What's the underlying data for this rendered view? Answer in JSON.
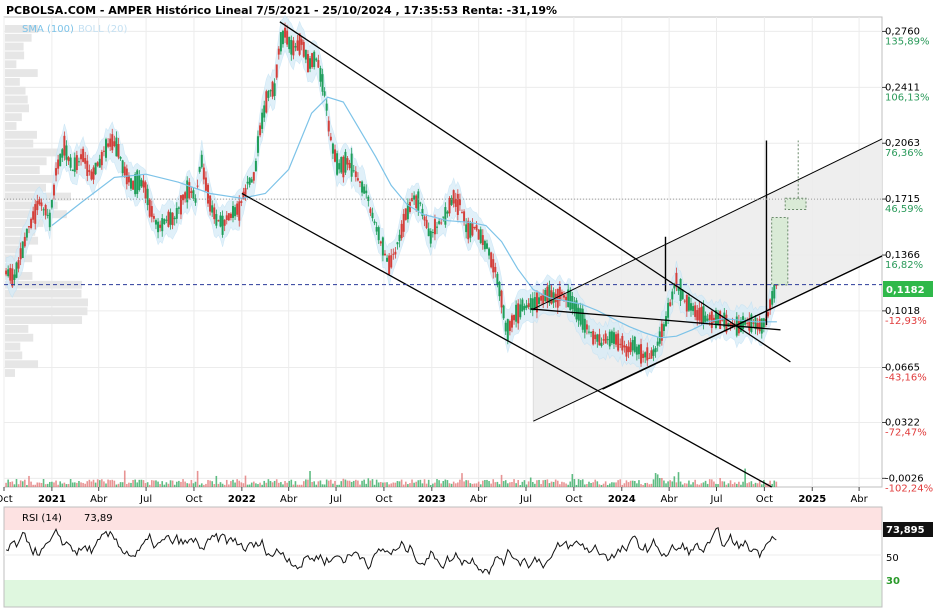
{
  "header": {
    "title": "PCBOLSA.COM - AMPER Histórico Lineal 7/5/2021 - 25/10/2024 , 17:35:53 Renta: -31,19%",
    "legend": [
      {
        "label": "SMA (100)",
        "color": "#7dc3e8"
      },
      {
        "label": "BOLL (20)",
        "color": "#c4e0f2"
      }
    ]
  },
  "chart_data": [
    {
      "type": "candlestick",
      "title": "PCBOLSA.COM - AMPER Histórico Lineal 7/5/2021 - 25/10/2024 , 17:35:53 Renta: -31,19%",
      "x_range": [
        "2020-10-01",
        "2025-05-15"
      ],
      "ylim": [
        -0.008,
        0.285
      ],
      "current_price": {
        "value": 0.1182,
        "label": "0,1182"
      },
      "price_ticks": [
        {
          "value": 0.276,
          "label": "0,2760",
          "pct": "135,89%",
          "color": "#2a9a5a"
        },
        {
          "value": 0.2411,
          "label": "0,2411",
          "pct": "106,13%",
          "color": "#2a9a5a"
        },
        {
          "value": 0.2063,
          "label": "0,2063",
          "pct": "76,36%",
          "color": "#2a9a5a"
        },
        {
          "value": 0.1715,
          "label": "0,1715",
          "pct": "46,59%",
          "color": "#2a9a5a"
        },
        {
          "value": 0.1366,
          "label": "0,1366",
          "pct": "16,82%",
          "color": "#2a9a5a"
        },
        {
          "value": 0.1018,
          "label": "0,1018",
          "pct": "-12,93%",
          "color": "#e03c3c"
        },
        {
          "value": 0.0665,
          "label": "0,0665",
          "pct": "-43,16%",
          "color": "#e03c3c"
        },
        {
          "value": 0.0322,
          "label": "0,0322",
          "pct": "-72,47%",
          "color": "#e03c3c"
        },
        {
          "value": -0.0026,
          "label": "-0,0026",
          "pct": "-102,24%",
          "color": "#e03c3c"
        }
      ],
      "x_ticks": [
        {
          "date": "2020-10-01",
          "label": "Oct",
          "bold": false
        },
        {
          "date": "2021-01-01",
          "label": "2021",
          "bold": true
        },
        {
          "date": "2021-04-01",
          "label": "Abr",
          "bold": false
        },
        {
          "date": "2021-07-01",
          "label": "Jul",
          "bold": false
        },
        {
          "date": "2021-10-01",
          "label": "Oct",
          "bold": false
        },
        {
          "date": "2022-01-01",
          "label": "2022",
          "bold": true
        },
        {
          "date": "2022-04-01",
          "label": "Abr",
          "bold": false
        },
        {
          "date": "2022-07-01",
          "label": "Jul",
          "bold": false
        },
        {
          "date": "2022-10-01",
          "label": "Oct",
          "bold": false
        },
        {
          "date": "2023-01-01",
          "label": "2023",
          "bold": true
        },
        {
          "date": "2023-04-01",
          "label": "Abr",
          "bold": false
        },
        {
          "date": "2023-07-01",
          "label": "Jul",
          "bold": false
        },
        {
          "date": "2023-10-01",
          "label": "Oct",
          "bold": false
        },
        {
          "date": "2024-01-01",
          "label": "2024",
          "bold": true
        },
        {
          "date": "2024-04-01",
          "label": "Abr",
          "bold": false
        },
        {
          "date": "2024-07-01",
          "label": "Jul",
          "bold": false
        },
        {
          "date": "2024-10-01",
          "label": "Oct",
          "bold": false
        },
        {
          "date": "2025-01-01",
          "label": "2025",
          "bold": true
        },
        {
          "date": "2025-04-01",
          "label": "Abr",
          "bold": false
        }
      ],
      "price_path": [
        [
          "2020-10-01",
          0.128
        ],
        [
          "2020-10-20",
          0.122
        ],
        [
          "2020-11-10",
          0.145
        ],
        [
          "2020-11-25",
          0.16
        ],
        [
          "2020-12-10",
          0.17
        ],
        [
          "2020-12-28",
          0.158
        ],
        [
          "2021-01-10",
          0.19
        ],
        [
          "2021-01-25",
          0.205
        ],
        [
          "2021-02-10",
          0.19
        ],
        [
          "2021-03-01",
          0.198
        ],
        [
          "2021-03-20",
          0.185
        ],
        [
          "2021-04-10",
          0.2
        ],
        [
          "2021-04-25",
          0.208
        ],
        [
          "2021-05-10",
          0.2
        ],
        [
          "2021-05-25",
          0.185
        ],
        [
          "2021-06-10",
          0.18
        ],
        [
          "2021-06-25",
          0.182
        ],
        [
          "2021-07-10",
          0.165
        ],
        [
          "2021-07-25",
          0.153
        ],
        [
          "2021-08-10",
          0.16
        ],
        [
          "2021-08-25",
          0.158
        ],
        [
          "2021-09-10",
          0.172
        ],
        [
          "2021-09-25",
          0.178
        ],
        [
          "2021-10-05",
          0.17
        ],
        [
          "2021-10-15",
          0.198
        ],
        [
          "2021-10-25",
          0.178
        ],
        [
          "2021-11-10",
          0.16
        ],
        [
          "2021-11-25",
          0.155
        ],
        [
          "2021-12-10",
          0.162
        ],
        [
          "2021-12-28",
          0.165
        ],
        [
          "2022-01-10",
          0.18
        ],
        [
          "2022-01-25",
          0.185
        ],
        [
          "2022-02-05",
          0.215
        ],
        [
          "2022-02-20",
          0.238
        ],
        [
          "2022-03-05",
          0.24
        ],
        [
          "2022-03-15",
          0.268
        ],
        [
          "2022-03-25",
          0.275
        ],
        [
          "2022-04-10",
          0.265
        ],
        [
          "2022-04-25",
          0.27
        ],
        [
          "2022-05-10",
          0.255
        ],
        [
          "2022-05-25",
          0.26
        ],
        [
          "2022-06-10",
          0.235
        ],
        [
          "2022-06-20",
          0.21
        ],
        [
          "2022-07-05",
          0.19
        ],
        [
          "2022-07-25",
          0.195
        ],
        [
          "2022-08-10",
          0.185
        ],
        [
          "2022-08-25",
          0.178
        ],
        [
          "2022-09-10",
          0.16
        ],
        [
          "2022-09-25",
          0.145
        ],
        [
          "2022-10-10",
          0.13
        ],
        [
          "2022-10-25",
          0.14
        ],
        [
          "2022-11-10",
          0.16
        ],
        [
          "2022-11-25",
          0.172
        ],
        [
          "2022-12-10",
          0.168
        ],
        [
          "2022-12-28",
          0.148
        ],
        [
          "2023-01-10",
          0.155
        ],
        [
          "2023-01-25",
          0.16
        ],
        [
          "2023-02-10",
          0.172
        ],
        [
          "2023-02-25",
          0.168
        ],
        [
          "2023-03-10",
          0.152
        ],
        [
          "2023-03-25",
          0.155
        ],
        [
          "2023-04-05",
          0.148
        ],
        [
          "2023-04-20",
          0.14
        ],
        [
          "2023-05-05",
          0.125
        ],
        [
          "2023-05-15",
          0.11
        ],
        [
          "2023-05-25",
          0.088
        ],
        [
          "2023-06-10",
          0.098
        ],
        [
          "2023-06-25",
          0.105
        ],
        [
          "2023-07-10",
          0.105
        ],
        [
          "2023-07-25",
          0.108
        ],
        [
          "2023-08-10",
          0.112
        ],
        [
          "2023-08-25",
          0.11
        ],
        [
          "2023-09-10",
          0.112
        ],
        [
          "2023-09-25",
          0.108
        ],
        [
          "2023-10-10",
          0.1
        ],
        [
          "2023-10-25",
          0.092
        ],
        [
          "2023-11-10",
          0.085
        ],
        [
          "2023-11-25",
          0.082
        ],
        [
          "2023-12-10",
          0.085
        ],
        [
          "2023-12-28",
          0.082
        ],
        [
          "2024-01-10",
          0.078
        ],
        [
          "2024-01-25",
          0.08
        ],
        [
          "2024-02-10",
          0.075
        ],
        [
          "2024-02-25",
          0.073
        ],
        [
          "2024-03-10",
          0.08
        ],
        [
          "2024-03-25",
          0.095
        ],
        [
          "2024-04-05",
          0.11
        ],
        [
          "2024-04-15",
          0.12
        ],
        [
          "2024-04-25",
          0.112
        ],
        [
          "2024-05-10",
          0.105
        ],
        [
          "2024-05-25",
          0.1
        ],
        [
          "2024-06-10",
          0.098
        ],
        [
          "2024-06-25",
          0.095
        ],
        [
          "2024-07-10",
          0.097
        ],
        [
          "2024-07-25",
          0.094
        ],
        [
          "2024-08-10",
          0.092
        ],
        [
          "2024-08-25",
          0.095
        ],
        [
          "2024-09-10",
          0.094
        ],
        [
          "2024-09-25",
          0.092
        ],
        [
          "2024-10-05",
          0.096
        ],
        [
          "2024-10-15",
          0.108
        ],
        [
          "2024-10-25",
          0.1182
        ]
      ],
      "sma_path": [
        [
          "2021-01-01",
          0.155
        ],
        [
          "2021-03-01",
          0.17
        ],
        [
          "2021-05-01",
          0.185
        ],
        [
          "2021-07-01",
          0.187
        ],
        [
          "2021-09-01",
          0.182
        ],
        [
          "2021-11-01",
          0.175
        ],
        [
          "2022-01-01",
          0.172
        ],
        [
          "2022-02-15",
          0.175
        ],
        [
          "2022-04-01",
          0.19
        ],
        [
          "2022-05-15",
          0.225
        ],
        [
          "2022-06-15",
          0.235
        ],
        [
          "2022-07-15",
          0.232
        ],
        [
          "2022-08-15",
          0.215
        ],
        [
          "2022-09-15",
          0.198
        ],
        [
          "2022-10-15",
          0.18
        ],
        [
          "2022-11-15",
          0.168
        ],
        [
          "2022-12-15",
          0.162
        ],
        [
          "2023-02-01",
          0.158
        ],
        [
          "2023-03-15",
          0.157
        ],
        [
          "2023-04-15",
          0.155
        ],
        [
          "2023-05-15",
          0.145
        ],
        [
          "2023-06-15",
          0.128
        ],
        [
          "2023-07-15",
          0.115
        ],
        [
          "2023-08-15",
          0.11
        ],
        [
          "2023-09-15",
          0.108
        ],
        [
          "2023-10-15",
          0.106
        ],
        [
          "2023-11-15",
          0.102
        ],
        [
          "2023-12-15",
          0.097
        ],
        [
          "2024-01-15",
          0.092
        ],
        [
          "2024-02-15",
          0.088
        ],
        [
          "2024-03-15",
          0.085
        ],
        [
          "2024-04-15",
          0.086
        ],
        [
          "2024-05-15",
          0.09
        ],
        [
          "2024-06-15",
          0.095
        ],
        [
          "2024-07-15",
          0.097
        ],
        [
          "2024-08-15",
          0.096
        ],
        [
          "2024-09-15",
          0.095
        ],
        [
          "2024-10-25",
          0.095
        ]
      ],
      "annotations": [
        {
          "type": "trendline",
          "from": [
            "2022-01-01",
            0.175
          ],
          "to": [
            "2024-10-15",
            -0.008
          ]
        },
        {
          "type": "trendline",
          "from": [
            "2022-03-15",
            0.282
          ],
          "to": [
            "2024-11-20",
            0.07
          ]
        },
        {
          "type": "channel",
          "lower_from": [
            "2023-07-15",
            0.033
          ],
          "lower_to": [
            "2025-05-15",
            0.136
          ],
          "upper_from": [
            "2023-07-15",
            0.103
          ],
          "upper_to": [
            "2025-05-15",
            0.209
          ]
        },
        {
          "type": "trendline",
          "from": [
            "2023-11-25",
            0.053
          ],
          "to": [
            "2025-05-15",
            0.136
          ]
        },
        {
          "type": "trendline",
          "from": [
            "2023-07-10",
            0.103
          ],
          "to": [
            "2024-11-01",
            0.09
          ]
        },
        {
          "type": "vline",
          "at": "2024-03-25",
          "from": 0.114,
          "to": 0.148
        },
        {
          "type": "vline",
          "at": "2024-10-05",
          "from": 0.093,
          "to": 0.208
        },
        {
          "type": "target_box",
          "from": [
            "2024-10-15",
            0.118
          ],
          "to": [
            "2024-11-15",
            0.16
          ]
        },
        {
          "type": "target_box",
          "from": [
            "2024-11-10",
            0.165
          ],
          "to": [
            "2024-12-20",
            0.172
          ]
        },
        {
          "type": "target_line",
          "at": "2024-12-05",
          "from": 0.172,
          "to": 0.208
        }
      ]
    },
    {
      "type": "line",
      "title": "RSI (14)",
      "current": {
        "value": 73.89,
        "label": "73,89",
        "badge": "73,895"
      },
      "ylim": [
        0,
        100
      ],
      "y_ticks": [
        {
          "value": 50,
          "label": "50"
        },
        {
          "value": 30,
          "label": "30"
        }
      ],
      "zones": [
        {
          "from": 70,
          "to": 100,
          "color": "#fde2e2"
        },
        {
          "from": 0,
          "to": 30,
          "color": "#dff7df"
        }
      ]
    }
  ]
}
